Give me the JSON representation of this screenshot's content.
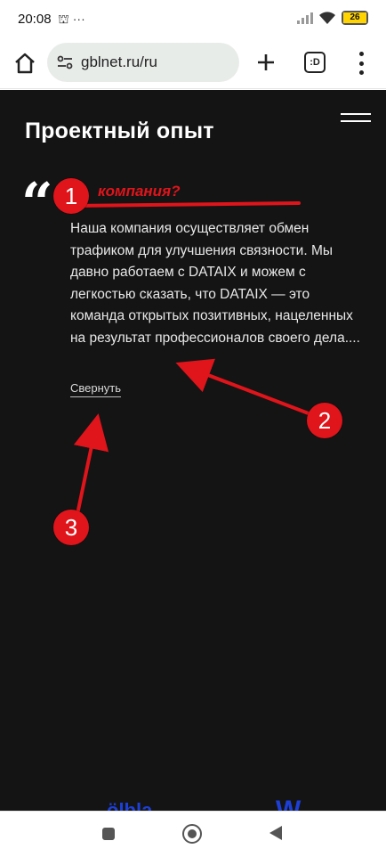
{
  "status_bar": {
    "time": "20:08",
    "left_icons": "⛫ ···",
    "battery_level": "26",
    "battery_color": "#ffd400"
  },
  "browser": {
    "url": "gblnet.ru/ru",
    "tab_label": ":D",
    "icons": [
      "home-icon",
      "site-settings-icon",
      "plus-icon",
      "tab-switcher-icon",
      "more-vert-icon"
    ]
  },
  "page": {
    "title": "Проектный опыт",
    "quote_glyph": "“",
    "review_text": "Наша компания осуществляет обмен трафиком для улучшения связности. Мы давно работаем с DATAIX и можем с легкостью сказать, что DATAIX — это команда открытых позитивных, нацеленных на результат профессионалов своего дела....",
    "collapse_label": "Свернуть",
    "background": "#141414"
  },
  "annotations": {
    "question_text": "компания?",
    "badges": [
      "1",
      "2",
      "3"
    ],
    "color": "#e0141b"
  },
  "logos": {
    "items": [
      "ölbla",
      "W"
    ],
    "color": "#1d3fd6"
  }
}
